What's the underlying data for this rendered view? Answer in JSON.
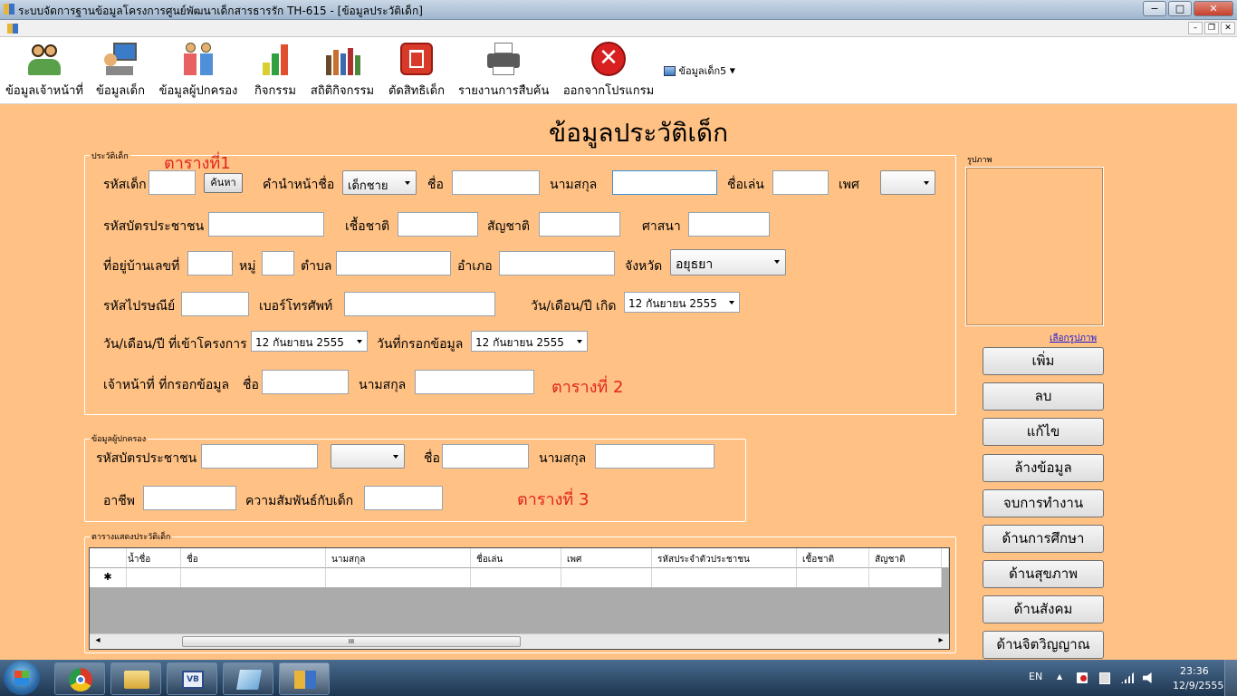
{
  "window": {
    "title": "ระบบจัดการฐานข้อมูลโครงการศูนย์พัฒนาเด็กสารธารรัก TH-615 - [ข้อมูลประวัติเด็ก]",
    "minimize": "−",
    "maximize": "□",
    "close": "✕"
  },
  "mdi": {
    "minimize": "–",
    "restore": "❐",
    "close": "✕"
  },
  "toolbar": {
    "items": [
      {
        "label": "ข้อมูลเจ้าหน้าที่",
        "icon": "staff-icon"
      },
      {
        "label": "ข้อมูลเด็ก",
        "icon": "child-computer-icon"
      },
      {
        "label": "ข้อมูลผู้ปกครอง",
        "icon": "parents-icon"
      },
      {
        "label": "กิจกรรม",
        "icon": "chart-icon"
      },
      {
        "label": "สถิติกิจกรรม",
        "icon": "people-stats-icon"
      },
      {
        "label": "ตัดสิทธิเด็ก",
        "icon": "trash-icon"
      },
      {
        "label": "รายงานการสืบค้น",
        "icon": "printer-icon"
      },
      {
        "label": "ออกจากโปรแกรม",
        "icon": "exit-icon"
      }
    ],
    "dropdown": "ข้อมูลเด็ก5"
  },
  "page_title": "ข้อมูลประวัติเด็ก",
  "child_group": {
    "title": "ประวัติเด็ก",
    "note1": "ตารางที่1",
    "child_id_label": "รหัสเด็ก",
    "search_button": "ค้นหา",
    "prefix_label": "คำนำหน้าชื่อ",
    "prefix_value": "เด็กชาย",
    "name_label": "ชื่อ",
    "surname_label": "นามสกุล",
    "nickname_label": "ชื่อเล่น",
    "gender_label": "เพศ",
    "gender_value": "",
    "citizen_id_label": "รหัสบัตรประชาชน",
    "race_label": "เชื้อชาติ",
    "nationality_label": "สัญชาติ",
    "religion_label": "ศาสนา",
    "house_no_label": "ที่อยู่บ้านเลขที่",
    "moo_label": "หมู่",
    "tambon_label": "ตำบล",
    "amphoe_label": "อำเภอ",
    "province_label": "จังหวัด",
    "province_value": "อยุธยา",
    "postcode_label": "รหัสไปรษณีย์",
    "phone_label": "เบอร์โทรศัพท์",
    "birth_label": "วัน/เดือน/ปี เกิด",
    "birth_value": "12  กันยายน    2555",
    "join_label": "วัน/เดือน/ปี ที่เข้าโครงการ",
    "join_value": "12  กันยายน    2555",
    "entry_date_label": "วันที่กรอกข้อมูล",
    "entry_date_value": "12  กันยายน    2555",
    "staff_label": "เจ้าหน้าที่ ที่กรอกข้อมูล",
    "staff_name_label": "ชื่อ",
    "staff_surname_label": "นามสกุล",
    "note2": "ตารางที่   2"
  },
  "parent_group": {
    "title": "ข้อมูลผู้ปกครอง",
    "citizen_id_label": "รหัสบัตรประชาชน",
    "prefix_value": "",
    "name_label": "ชื่อ",
    "surname_label": "นามสกุล",
    "occupation_label": "อาชีพ",
    "relation_label": "ความสัมพันธ์กับเด็ก",
    "note3": "ตารางที่   3"
  },
  "grid_group": {
    "title": "ตารางแสดงประวัติเด็ก",
    "columns": [
      "น้ำชื่อ",
      "ชื่อ",
      "นามสกุล",
      "ชื่อเล่น",
      "เพศ",
      "รหัสประจำตัวประชาชน",
      "เชื้อชาติ",
      "สัญชาติ"
    ],
    "new_row_marker": "✱",
    "scroll_left": "◂",
    "scroll_right": "▸",
    "scroll_grip": "III"
  },
  "photo": {
    "title": "รูปภาพ",
    "select_link": "เลือกรูปภาพ"
  },
  "side_buttons": [
    "เพิ่ม",
    "ลบ",
    "แก้ไข",
    "ล้างข้อมูล",
    "จบการทำงาน",
    "ด้านการศึกษา",
    "ด้านสุขภาพ",
    "ด้านสังคม",
    "ด้านจิตวิญญาณ"
  ],
  "taskbar": {
    "lang": "EN",
    "time": "23:36",
    "date": "12/9/2555",
    "tray_up": "▲"
  },
  "colors": {
    "form_bg": "#ffc184",
    "note_red": "#e0261c",
    "link_blue": "#1a1ad6"
  }
}
